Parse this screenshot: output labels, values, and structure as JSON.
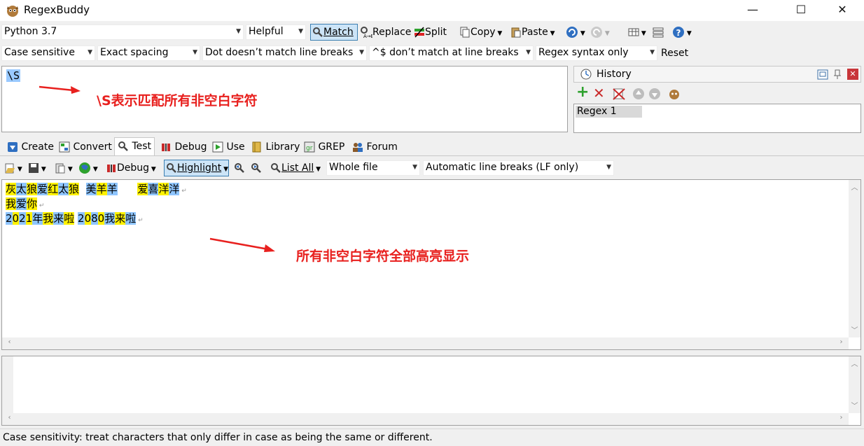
{
  "window": {
    "title": "RegexBuddy",
    "minimize": "—",
    "maximize": "☐",
    "close": "✕"
  },
  "toolbar1": {
    "flavor": "Python 3.7",
    "mode": "Helpful",
    "match": "Match",
    "replace": "Replace",
    "split": "Split",
    "copy": "Copy",
    "paste": "Paste"
  },
  "toolbar2": {
    "case": "Case sensitive",
    "spacing": "Exact spacing",
    "dot": "Dot doesn’t match line breaks",
    "anchors": "^$ don’t match at line breaks",
    "syntax": "Regex syntax only",
    "reset": "Reset"
  },
  "regex": {
    "value": "\\S",
    "annotation": "\\S表示匹配所有非空白字符"
  },
  "history": {
    "title": "History",
    "items": [
      "Regex 1"
    ]
  },
  "tabs": [
    "Create",
    "Convert",
    "Test",
    "Debug",
    "Use",
    "Library",
    "GREP",
    "Forum"
  ],
  "test_toolbar": {
    "debug": "Debug",
    "highlight": "Highlight",
    "list_all": "List All",
    "scope": "Whole file",
    "line_breaks": "Automatic line breaks (LF only)"
  },
  "subject": {
    "lines": [
      {
        "segments": [
          {
            "t": "灰",
            "c": "y"
          },
          {
            "t": "太",
            "c": "b"
          },
          {
            "t": "狼",
            "c": "y"
          },
          {
            "t": "爱",
            "c": "b"
          },
          {
            "t": "红",
            "c": "y"
          },
          {
            "t": "太",
            "c": "b"
          },
          {
            "t": "狼",
            "c": "y"
          },
          {
            "t": "  ",
            "c": ""
          },
          {
            "t": "美",
            "c": "b"
          },
          {
            "t": "羊",
            "c": "y"
          },
          {
            "t": "羊",
            "c": "b"
          },
          {
            "t": "      ",
            "c": ""
          },
          {
            "t": "爱",
            "c": "y"
          },
          {
            "t": "喜",
            "c": "b"
          },
          {
            "t": "洋",
            "c": "y"
          },
          {
            "t": "洋",
            "c": "b"
          }
        ]
      },
      {
        "segments": [
          {
            "t": "我",
            "c": "y"
          },
          {
            "t": "爱",
            "c": "b"
          },
          {
            "t": "你",
            "c": "y"
          }
        ]
      },
      {
        "segments": [
          {
            "t": "2",
            "c": "b"
          },
          {
            "t": "0",
            "c": "y"
          },
          {
            "t": "2",
            "c": "b"
          },
          {
            "t": "1",
            "c": "y"
          },
          {
            "t": "年",
            "c": "b"
          },
          {
            "t": "我",
            "c": "y"
          },
          {
            "t": "来",
            "c": "b"
          },
          {
            "t": "啦",
            "c": "y"
          },
          {
            "t": " ",
            "c": ""
          },
          {
            "t": "2",
            "c": "b"
          },
          {
            "t": "0",
            "c": "y"
          },
          {
            "t": "8",
            "c": "b"
          },
          {
            "t": "0",
            "c": "y"
          },
          {
            "t": "我",
            "c": "b"
          },
          {
            "t": "来",
            "c": "y"
          },
          {
            "t": "啦",
            "c": "b"
          }
        ]
      }
    ],
    "annotation": "所有非空白字符全部高亮显示"
  },
  "status": "Case sensitivity: treat characters that only differ in case as being the same or different.",
  "colors": {
    "highlight_yellow": "#fff200",
    "highlight_blue": "#8ec5ff",
    "annotation_red": "#e8201e"
  }
}
